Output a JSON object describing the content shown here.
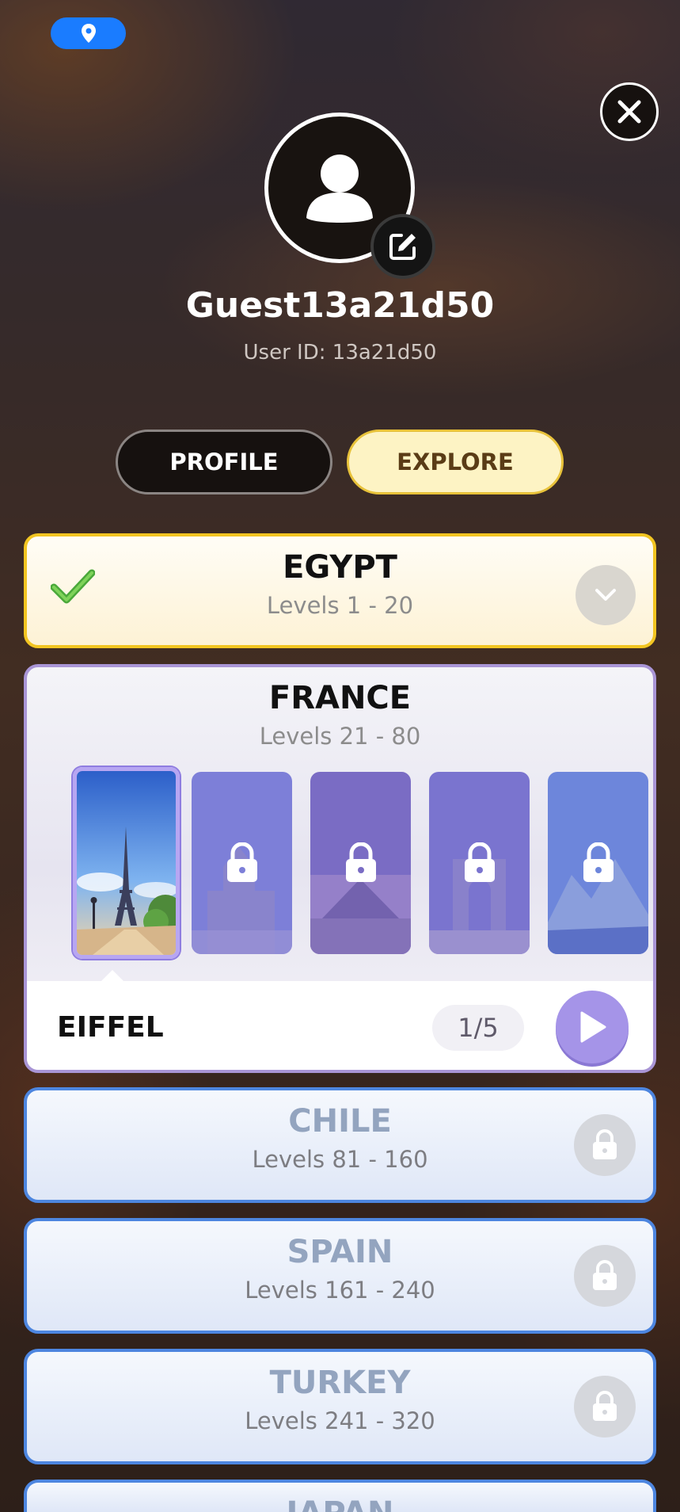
{
  "header": {
    "close_icon": "close-icon",
    "location_icon": "location-pin-icon"
  },
  "profile": {
    "username": "Guest13a21d50",
    "user_id": "User ID: 13a21d50"
  },
  "tabs": {
    "profile_label": "PROFILE",
    "explore_label": "EXPLORE",
    "active": "EXPLORE"
  },
  "destinations": [
    {
      "name": "EGYPT",
      "levels": "Levels 1 - 20",
      "status": "completed"
    },
    {
      "name": "FRANCE",
      "levels": "Levels 21 - 80",
      "status": "current"
    },
    {
      "name": "CHILE",
      "levels": "Levels 81 - 160",
      "status": "locked"
    },
    {
      "name": "SPAIN",
      "levels": "Levels 161 - 240",
      "status": "locked"
    },
    {
      "name": "TURKEY",
      "levels": "Levels 241 - 320",
      "status": "locked"
    },
    {
      "name": "JAPAN",
      "levels": "",
      "status": "locked"
    }
  ],
  "france": {
    "selected_scene": "EIFFEL",
    "progress": "1/5",
    "scenes": [
      {
        "scene": "eiffel-tower",
        "locked": false
      },
      {
        "scene": "cathedral",
        "locked": true
      },
      {
        "scene": "louvre-pyramid",
        "locked": true
      },
      {
        "scene": "arc-de-triomphe",
        "locked": true
      },
      {
        "scene": "alps-lake",
        "locked": true
      }
    ]
  },
  "colors": {
    "accent_blue": "#1a7cff",
    "gold_border": "#f2c522",
    "purple": "#a594e8",
    "locked_border": "#4d86e0"
  }
}
